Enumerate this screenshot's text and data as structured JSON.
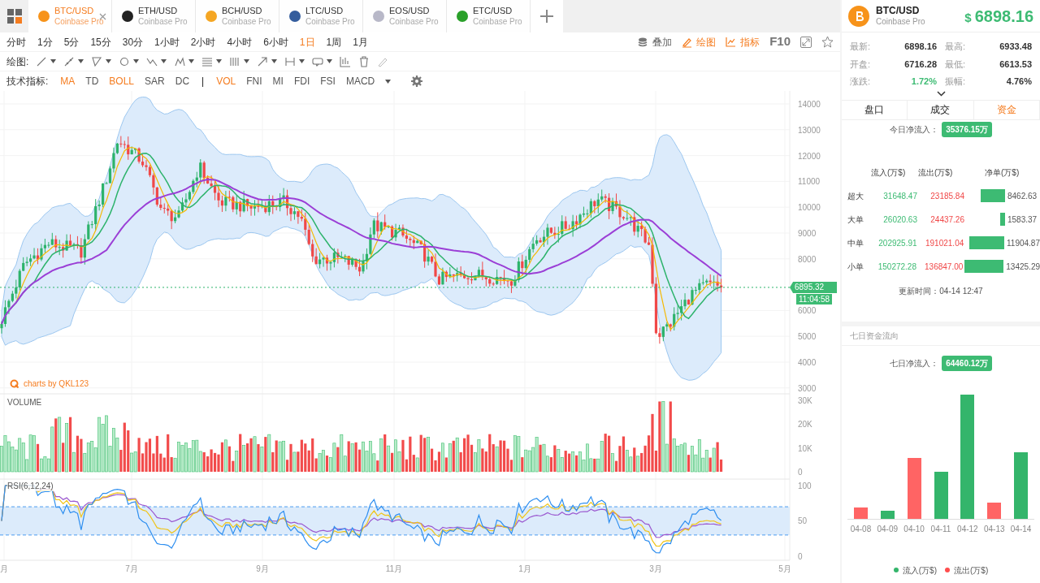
{
  "tabs": [
    {
      "symbol": "BTC/USD",
      "exchange": "Coinbase Pro",
      "color": "#f7931a",
      "selected": true
    },
    {
      "symbol": "ETH/USD",
      "exchange": "Coinbase Pro",
      "color": "#222222",
      "selected": false
    },
    {
      "symbol": "BCH/USD",
      "exchange": "Coinbase Pro",
      "color": "#f5a623",
      "selected": false
    },
    {
      "symbol": "LTC/USD",
      "exchange": "Coinbase Pro",
      "color": "#345d9d",
      "selected": false
    },
    {
      "symbol": "EOS/USD",
      "exchange": "Coinbase Pro",
      "color": "#b8b8c8",
      "selected": false
    },
    {
      "symbol": "ETC/USD",
      "exchange": "Coinbase Pro",
      "color": "#2aa02a",
      "selected": false
    }
  ],
  "periods": [
    {
      "label": "分时",
      "selected": false
    },
    {
      "label": "1分",
      "selected": false
    },
    {
      "label": "5分",
      "selected": false
    },
    {
      "label": "15分",
      "selected": false
    },
    {
      "label": "30分",
      "selected": false
    },
    {
      "label": "1小时",
      "selected": false
    },
    {
      "label": "2小时",
      "selected": false
    },
    {
      "label": "4小时",
      "selected": false
    },
    {
      "label": "6小时",
      "selected": false
    },
    {
      "label": "1日",
      "selected": true
    },
    {
      "label": "1周",
      "selected": false
    },
    {
      "label": "1月",
      "selected": false
    }
  ],
  "toolbar_actions": [
    {
      "kind": "layers",
      "label": "叠加",
      "active": false
    },
    {
      "kind": "draw",
      "label": "绘图",
      "active": true
    },
    {
      "kind": "indicator",
      "label": "指标",
      "active": true
    }
  ],
  "f10_label": "F10",
  "drawing_label": "绘图:",
  "indicators": {
    "label": "技术指标:",
    "items": [
      {
        "kind": "indicator",
        "label": "MA",
        "active": true
      },
      {
        "kind": "indicator",
        "label": "TD",
        "active": false
      },
      {
        "kind": "indicator",
        "label": "BOLL",
        "active": true
      },
      {
        "kind": "indicator",
        "label": "SAR",
        "active": false
      },
      {
        "kind": "indicator",
        "label": "DC",
        "active": false
      },
      {
        "kind": "separator",
        "label": "|",
        "active": false
      },
      {
        "kind": "indicator",
        "label": "VOL",
        "active": true
      },
      {
        "kind": "indicator",
        "label": "FNI",
        "active": false
      },
      {
        "kind": "indicator",
        "label": "MI",
        "active": false
      },
      {
        "kind": "indicator",
        "label": "FDI",
        "active": false
      },
      {
        "kind": "indicator",
        "label": "FSI",
        "active": false
      },
      {
        "kind": "indicator",
        "label": "MACD",
        "active": false
      }
    ]
  },
  "chart": {
    "price_axis": [
      "14000",
      "13000",
      "12000",
      "11000",
      "10000",
      "9000",
      "8000",
      "6000",
      "5000",
      "4000",
      "3000"
    ],
    "current_price": "6895.32",
    "countdown": "11:04:58",
    "branding": "charts by QKL123",
    "volume_label": "VOLUME",
    "volume_axis": [
      "30K",
      "20K",
      "10K",
      "0"
    ],
    "rsi_label": "RSI(6,12,24)",
    "rsi_axis": [
      "100",
      "50",
      "0"
    ],
    "x_axis": [
      "月",
      "7月",
      "9月",
      "11月",
      "1月",
      "3月",
      "5月"
    ]
  },
  "ticker": {
    "symbol": "BTC/USD",
    "exchange": "Coinbase Pro",
    "currency": "$",
    "price": "6898.16"
  },
  "stats": [
    {
      "label": "最新:",
      "value": "6898.16",
      "color": "#333333"
    },
    {
      "label": "最高:",
      "value": "6933.48",
      "color": "#333333"
    },
    {
      "label": "开盘:",
      "value": "6716.28",
      "color": "#333333"
    },
    {
      "label": "最低:",
      "value": "6613.53",
      "color": "#333333"
    },
    {
      "label": "涨跌:",
      "value": "1.72%",
      "color": "#3dbb73"
    },
    {
      "label": "振幅:",
      "value": "4.76%",
      "color": "#333333"
    }
  ],
  "panel_tabs": [
    {
      "label": "盘口",
      "selected": false
    },
    {
      "label": "成交",
      "selected": false
    },
    {
      "label": "资金",
      "selected": true
    }
  ],
  "today_net": {
    "label": "今日净流入：",
    "value": "35376.15万"
  },
  "flow_table": {
    "columns": [
      "流入(万$)",
      "流出(万$)",
      "净单(万$)"
    ],
    "rows": [
      {
        "label": "超大",
        "inflow": "31648.47",
        "outflow": "23185.84",
        "net": "8462.63"
      },
      {
        "label": "大单",
        "inflow": "26020.63",
        "outflow": "24437.26",
        "net": "1583.37"
      },
      {
        "label": "中单",
        "inflow": "202925.91",
        "outflow": "191021.04",
        "net": "11904.87"
      },
      {
        "label": "小单",
        "inflow": "150272.28",
        "outflow": "136847.00",
        "net": "13425.29"
      }
    ]
  },
  "updated": "更新时间：04-14 12:47",
  "seven_day": {
    "title": "七日资金流向",
    "net_label": "七日净流入：",
    "net_value": "64460.12万",
    "days": [
      {
        "label": "04-08",
        "color": "#ff6464"
      },
      {
        "label": "04-09",
        "color": "#34b56b"
      },
      {
        "label": "04-10",
        "color": "#ff6464"
      },
      {
        "label": "04-11",
        "color": "#34b56b"
      },
      {
        "label": "04-12",
        "color": "#34b56b"
      },
      {
        "label": "04-13",
        "color": "#ff6464"
      },
      {
        "label": "04-14",
        "color": "#34b56b"
      }
    ],
    "legend": [
      {
        "label": "流入(万$)",
        "color": "#34b56b"
      },
      {
        "label": "流出(万$)",
        "color": "#ff4d4d"
      }
    ]
  }
}
